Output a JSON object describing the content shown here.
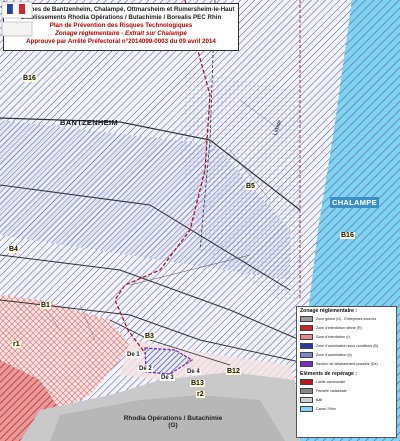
{
  "title": {
    "line1": "Communes de Bantzenheim, Chalampé, Ottmarsheim et Rumersheim-le-Haut",
    "line2": "Etablissements Rhodia Opérations / Butachimie / Borealis PEC Rhin",
    "line3": "Plan de Prévention des Risques Technologiques",
    "line4": "Zonage réglementaire - Extrait sur Chalampé",
    "line5": "Approuvé par Arrêté Préfectoral  n°2014099-0003  du  09 avril 2014"
  },
  "places": {
    "bantzenheim": "BANTZENHEIM",
    "chalampe": "CHALAMPE",
    "limite": "Limite",
    "rhodia": "Rhodia Opérations / Butachimie",
    "rhodia_g": "(G)"
  },
  "zones": {
    "b16_top": "B16",
    "b5": "B5",
    "b16_right": "B16",
    "b4": "B4",
    "b1": "B1",
    "r1": "r1",
    "b3": "B3",
    "de1": "De 1",
    "de2": "De 2",
    "de3": "De 3",
    "de4": "De 4",
    "b12": "B12",
    "b13": "B13",
    "r2": "r2"
  },
  "legend": {
    "zonage_title": "Zonage réglementaire :",
    "items": [
      {
        "label": "Zone grisée (G) - Entreprises sources",
        "color": "#9a9a9a"
      },
      {
        "label": "Zone d'interdiction stricte (R)",
        "color": "#c62828"
      },
      {
        "label": "Zone d'interdiction (r)",
        "color": "#e08c8c"
      },
      {
        "label": "Zone d'autorisation sous conditions (B)",
        "color": "#2b3a99"
      },
      {
        "label": "Zone d'autorisation (b)",
        "color": "#7a88cc"
      },
      {
        "label": "Secteur de délaissement possible (De)",
        "color": "#7b2fbe"
      }
    ],
    "reperage_title": "Eléments de repérage :",
    "ref_items": [
      {
        "label": "Limite communale",
        "color": "#b8171c"
      },
      {
        "label": "Parcelle cadastrale",
        "color": "#888888"
      },
      {
        "label": "Bâti",
        "color": "#d0d0d0"
      },
      {
        "label": "Canal / Rhin",
        "color": "#7fd4f0"
      }
    ]
  }
}
